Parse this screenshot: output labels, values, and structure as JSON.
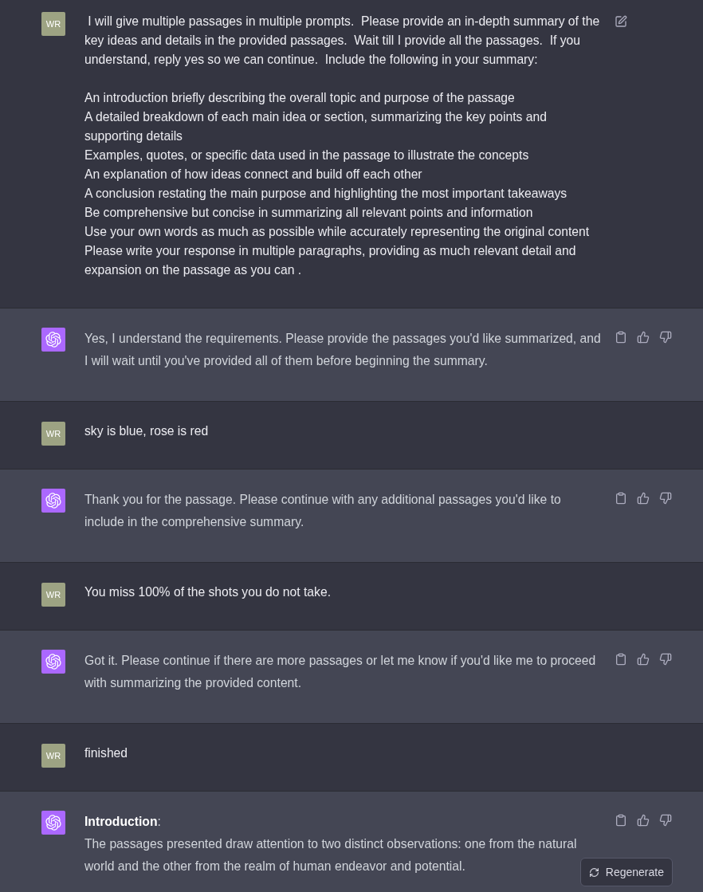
{
  "messages": [
    {
      "kind": "user",
      "avatar": "WR",
      "hovered": true,
      "text": " I will give multiple passages in multiple prompts.  Please provide an in-depth summary of the key ideas and details in the provided passages.  Wait till I provide all the passages.  If you understand, reply yes so we can continue.  Include the following in your summary:\n\nAn introduction briefly describing the overall topic and purpose of the passage\nA detailed breakdown of each main idea or section, summarizing the key points and supporting details\nExamples, quotes, or specific data used in the passage to illustrate the concepts\nAn explanation of how ideas connect and build off each other\nA conclusion restating the main purpose and highlighting the most important takeaways\nBe comprehensive but concise in summarizing all relevant points and information\nUse your own words as much as possible while accurately representing the original content\nPlease write your response in multiple paragraphs, providing as much relevant detail and expansion on the passage as you can ."
    },
    {
      "kind": "assistant",
      "paragraphs": [
        "Yes, I understand the requirements. Please provide the passages you'd like summarized, and I will wait until you've provided all of them before beginning the summary."
      ]
    },
    {
      "kind": "user",
      "avatar": "WR",
      "hovered": false,
      "text": "sky is blue, rose is red"
    },
    {
      "kind": "assistant",
      "paragraphs": [
        "Thank you for the passage. Please continue with any additional passages you'd like to include in the comprehensive summary."
      ]
    },
    {
      "kind": "user",
      "avatar": "WR",
      "hovered": false,
      "text": "You miss 100% of the shots you do not take."
    },
    {
      "kind": "assistant",
      "paragraphs": [
        "Got it. Please continue if there are more passages or let me know if you'd like me to proceed with summarizing the provided content."
      ]
    },
    {
      "kind": "user",
      "avatar": "WR",
      "hovered": false,
      "text": "finished"
    },
    {
      "kind": "assistant",
      "paragraphs": [
        "**Introduction**:",
        "The passages presented draw attention to two distinct observations: one from the natural world and the other from the realm of human endeavor and potential."
      ]
    }
  ],
  "regenerate_button": {
    "label": "Regenerate"
  }
}
